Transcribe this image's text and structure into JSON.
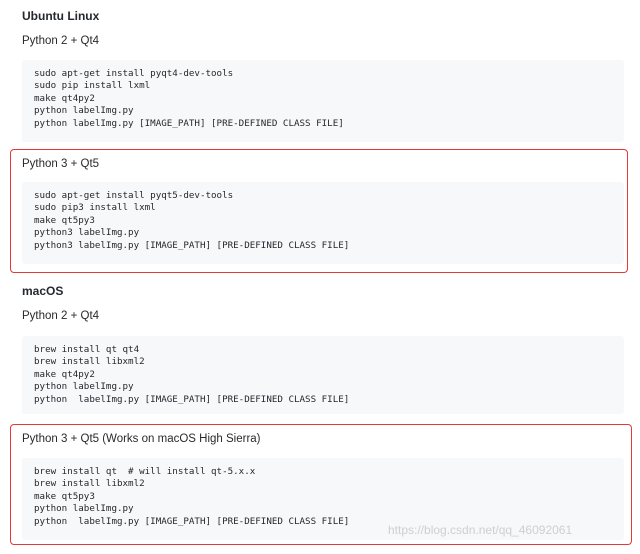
{
  "sections": [
    {
      "title": "Ubuntu Linux",
      "groups": [
        {
          "label": "Python 2 + Qt4",
          "lines": [
            "sudo apt-get install pyqt4-dev-tools",
            "sudo pip install lxml",
            "make qt4py2",
            "python labelImg.py",
            "python labelImg.py [IMAGE_PATH] [PRE-DEFINED CLASS FILE]"
          ]
        },
        {
          "label": "Python 3 + Qt5",
          "lines": [
            "sudo apt-get install pyqt5-dev-tools",
            "sudo pip3 install lxml",
            "make qt5py3",
            "python3 labelImg.py",
            "python3 labelImg.py [IMAGE_PATH] [PRE-DEFINED CLASS FILE]"
          ]
        }
      ]
    },
    {
      "title": "macOS",
      "groups": [
        {
          "label": "Python 2 + Qt4",
          "lines": [
            "brew install qt qt4",
            "brew install libxml2",
            "make qt4py2",
            "python labelImg.py",
            "python  labelImg.py [IMAGE_PATH] [PRE-DEFINED CLASS FILE]"
          ]
        },
        {
          "label": "Python 3 + Qt5 (Works on macOS High Sierra)",
          "lines": [
            "brew install qt  # will install qt-5.x.x",
            "brew install libxml2",
            "make qt5py3",
            "python labelImg.py",
            "python  labelImg.py [IMAGE_PATH] [PRE-DEFINED CLASS FILE]"
          ]
        }
      ]
    }
  ],
  "watermark": "https://blog.csdn.net/qq_46092061",
  "colors": {
    "highlight": "#e53935",
    "code_bg": "#f6f8fa"
  }
}
